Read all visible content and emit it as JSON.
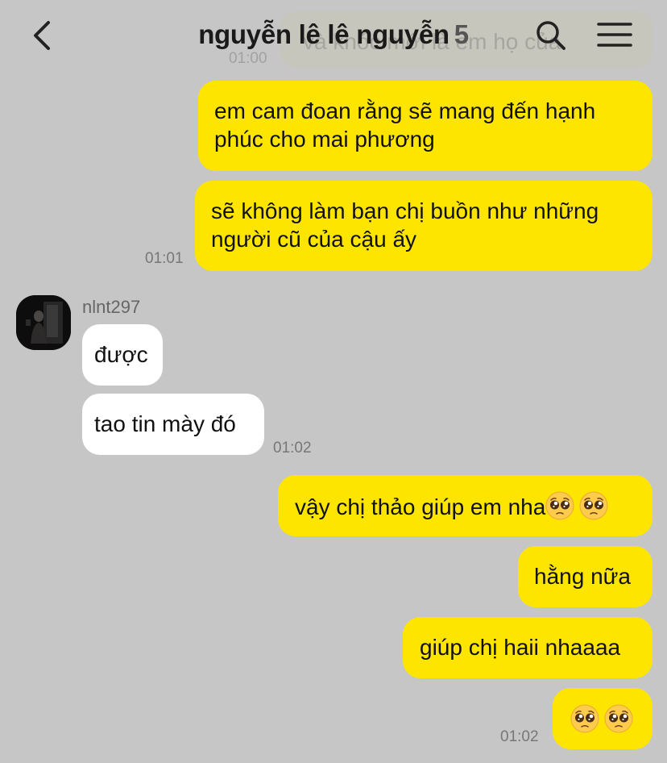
{
  "header": {
    "title": "nguyễn lê lê nguyễn",
    "member_count": "5"
  },
  "ghost": {
    "text": "và khóc mới là em họ của",
    "time": "01:00"
  },
  "sender": {
    "name": "nlnt297"
  },
  "messages": {
    "m1_line1": "em cam đoan rằng sẽ mang đến hạnh",
    "m1_line2": "phúc cho mai phương",
    "m2_line1": "sẽ không làm bạn chị buồn như những",
    "m2_line2": "người cũ của cậu ấy",
    "m2_time": "01:01",
    "m3": "được",
    "m4": "tao tin mày đó",
    "m4_time": "01:02",
    "m5": "vậy chị thảo giúp em nha",
    "m6": "hằng nữa",
    "m7": "giúp chị haii nhaaaa",
    "m8_time": "01:02"
  },
  "icons": {
    "back": "chevron-left-icon",
    "search": "search-icon",
    "menu": "hamburger-menu-icon",
    "emoji": "pleading-face-emoji"
  },
  "colors": {
    "background": "#c6c6c6",
    "my_bubble": "#fee500",
    "their_bubble": "#ffffff"
  }
}
